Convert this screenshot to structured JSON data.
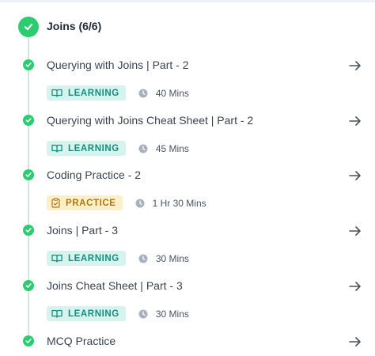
{
  "section": {
    "title": "Joins (6/6)",
    "icon": "check-circle-icon",
    "accent": "#2ecc71"
  },
  "items": [
    {
      "title": "Querying with Joins | Part - 2",
      "badge": "LEARNING",
      "type": "learning",
      "duration": "40 Mins"
    },
    {
      "title": "Querying with Joins Cheat Sheet | Part - 2",
      "badge": "LEARNING",
      "type": "learning",
      "duration": "45 Mins"
    },
    {
      "title": "Coding Practice - 2",
      "badge": "PRACTICE",
      "type": "practice",
      "duration": "1 Hr 30 Mins"
    },
    {
      "title": "Joins | Part - 3",
      "badge": "LEARNING",
      "type": "learning",
      "duration": "30 Mins"
    },
    {
      "title": "Joins Cheat Sheet | Part - 3",
      "badge": "LEARNING",
      "type": "learning",
      "duration": "30 Mins"
    },
    {
      "title": "MCQ Practice"
    }
  ],
  "colors": {
    "learning_bg": "#d7f3ee",
    "learning_text": "#118f7f",
    "practice_bg": "#fdf0c8",
    "practice_text": "#b2770f",
    "completed": "#2ecc71"
  }
}
